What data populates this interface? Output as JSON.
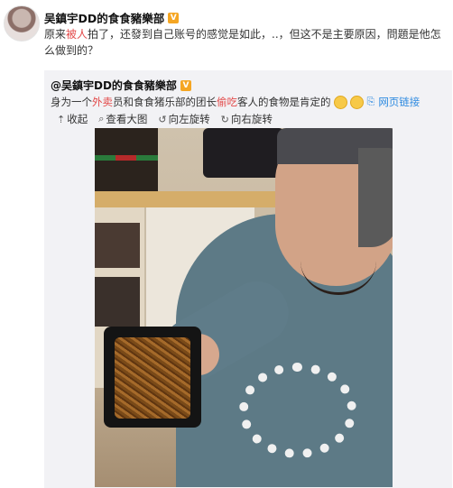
{
  "post": {
    "author": "吴鎮宇DD的食食豬樂部",
    "text_part1": "原来",
    "text_highlight": "被人",
    "text_part2": "拍了，还發到自己账号的感觉是如此，..，但这不是主要原因，問題是他怎么做到的？"
  },
  "quote": {
    "author": "@吴鎮宇DD的食食豬樂部",
    "text_part1": "身为一个",
    "text_highlight1": "外卖",
    "text_part2": "员和食食猪乐部的团长",
    "text_highlight2": "偷吃",
    "text_part3": "客人的食物是肯定的",
    "link_label": "网页链接"
  },
  "toolbar": {
    "collapse": "收起",
    "view_large": "查看大图",
    "rotate_left": "向左旋转",
    "rotate_right": "向右旋转"
  },
  "colors": {
    "highlight": "#e34a4a",
    "link": "#2d8ae0",
    "quote_bg": "#f2f2f5"
  },
  "icons": {
    "verified": "verified-badge-icon",
    "collapse": "arrow-up-icon",
    "view": "magnifier-icon",
    "rotate_left": "rotate-left-icon",
    "rotate_right": "rotate-right-icon",
    "link": "link-icon"
  }
}
